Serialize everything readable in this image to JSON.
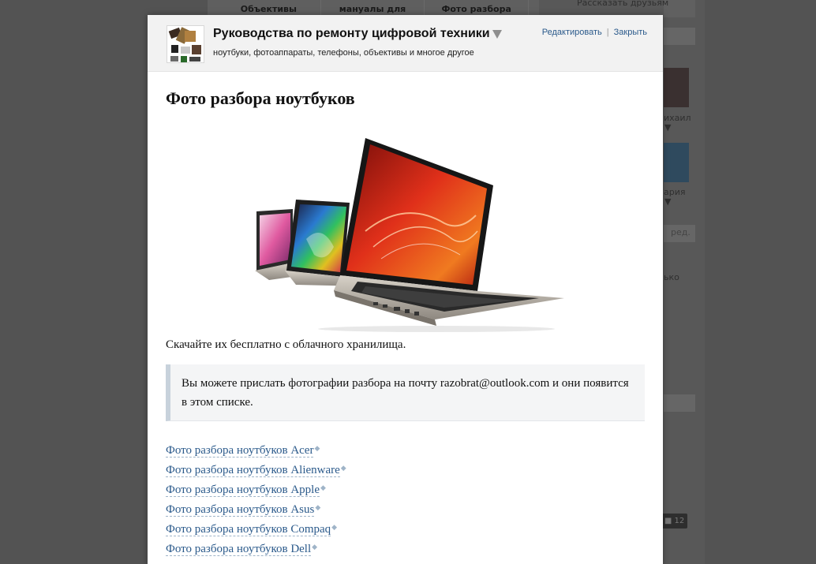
{
  "background": {
    "tabs": [
      "Объективы",
      "мануалы для",
      "Фото разбора"
    ],
    "side_texts": {
      "share": "Рассказать друзьям",
      "friend1": "ихаил",
      "friend2": "ария",
      "edit": "ред.",
      "misc": "ько"
    },
    "badge_count": "12"
  },
  "header": {
    "title": "Руководства по ремонту цифровой техники",
    "subtitle": "ноутбуки, фотоаппараты, телефоны, объективы и многое другое",
    "edit_label": "Редактировать",
    "separator": "|",
    "close_label": "Закрыть"
  },
  "content": {
    "page_title": "Фото разбора ноутбуков",
    "intro": "Скачайте их бесплатно с облачного хранилища.",
    "note": "Вы можете прислать фотографии разбора на почту razobrat@outlook.com и они появится в этом списке.",
    "links": [
      "Фото разбора ноутбуков Acer",
      "Фото разбора ноутбуков Alienware",
      "Фото разбора ноутбуков Apple",
      "Фото разбора ноутбуков Asus",
      "Фото разбора ноутбуков Compaq",
      "Фото разбора ноутбуков Dell"
    ]
  },
  "colors": {
    "link": "#2b5a8b",
    "overlay": "#535353",
    "header_bg": "#f2f2f2",
    "note_bg": "#f4f5f6",
    "note_border": "#c8d2dc"
  },
  "icons": {
    "title_dropdown": "triangle-down-icon",
    "app_logo": "devices-collage-icon",
    "external_link": "external-link-icon"
  }
}
